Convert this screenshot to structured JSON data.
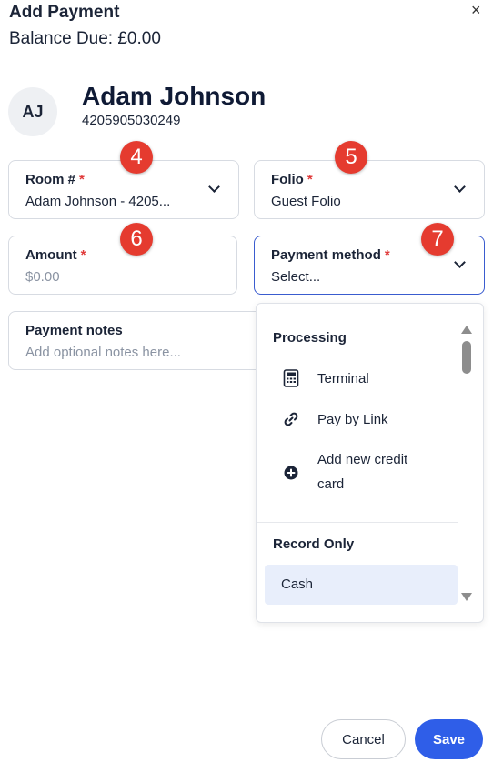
{
  "header": {
    "title": "Add Payment",
    "balance": "Balance Due: £0.00",
    "close_glyph": "×"
  },
  "guest": {
    "initials": "AJ",
    "name": "Adam Johnson",
    "id": "4205905030249"
  },
  "fields": {
    "room": {
      "label": "Room #",
      "required": "*",
      "value": "Adam Johnson - 4205..."
    },
    "folio": {
      "label": "Folio",
      "required": "*",
      "value": "Guest Folio"
    },
    "amount": {
      "label": "Amount",
      "required": "*",
      "placeholder": "$0.00"
    },
    "payment_method": {
      "label": "Payment method",
      "required": "*",
      "value": "Select..."
    },
    "notes": {
      "label": "Payment notes",
      "placeholder": "Add optional notes here..."
    }
  },
  "badges": {
    "room": "4",
    "folio": "5",
    "amount": "6",
    "payment_method": "7"
  },
  "dropdown": {
    "sections": [
      {
        "title": "Processing",
        "items": [
          {
            "label": "Terminal",
            "icon": "terminal-icon"
          },
          {
            "label": "Pay by Link",
            "icon": "link-icon"
          },
          {
            "label_line1": "Add new credit",
            "label_line2": "card",
            "icon": "plus-circle-icon"
          }
        ]
      },
      {
        "title": "Record Only",
        "items": [
          {
            "label": "Cash"
          }
        ]
      }
    ]
  },
  "actions": {
    "cancel": "Cancel",
    "save": "Save"
  },
  "colors": {
    "accent": "#2f5ee8",
    "badge": "#e53b2f",
    "required": "#e03a3a",
    "highlight": "#e8eefb"
  }
}
